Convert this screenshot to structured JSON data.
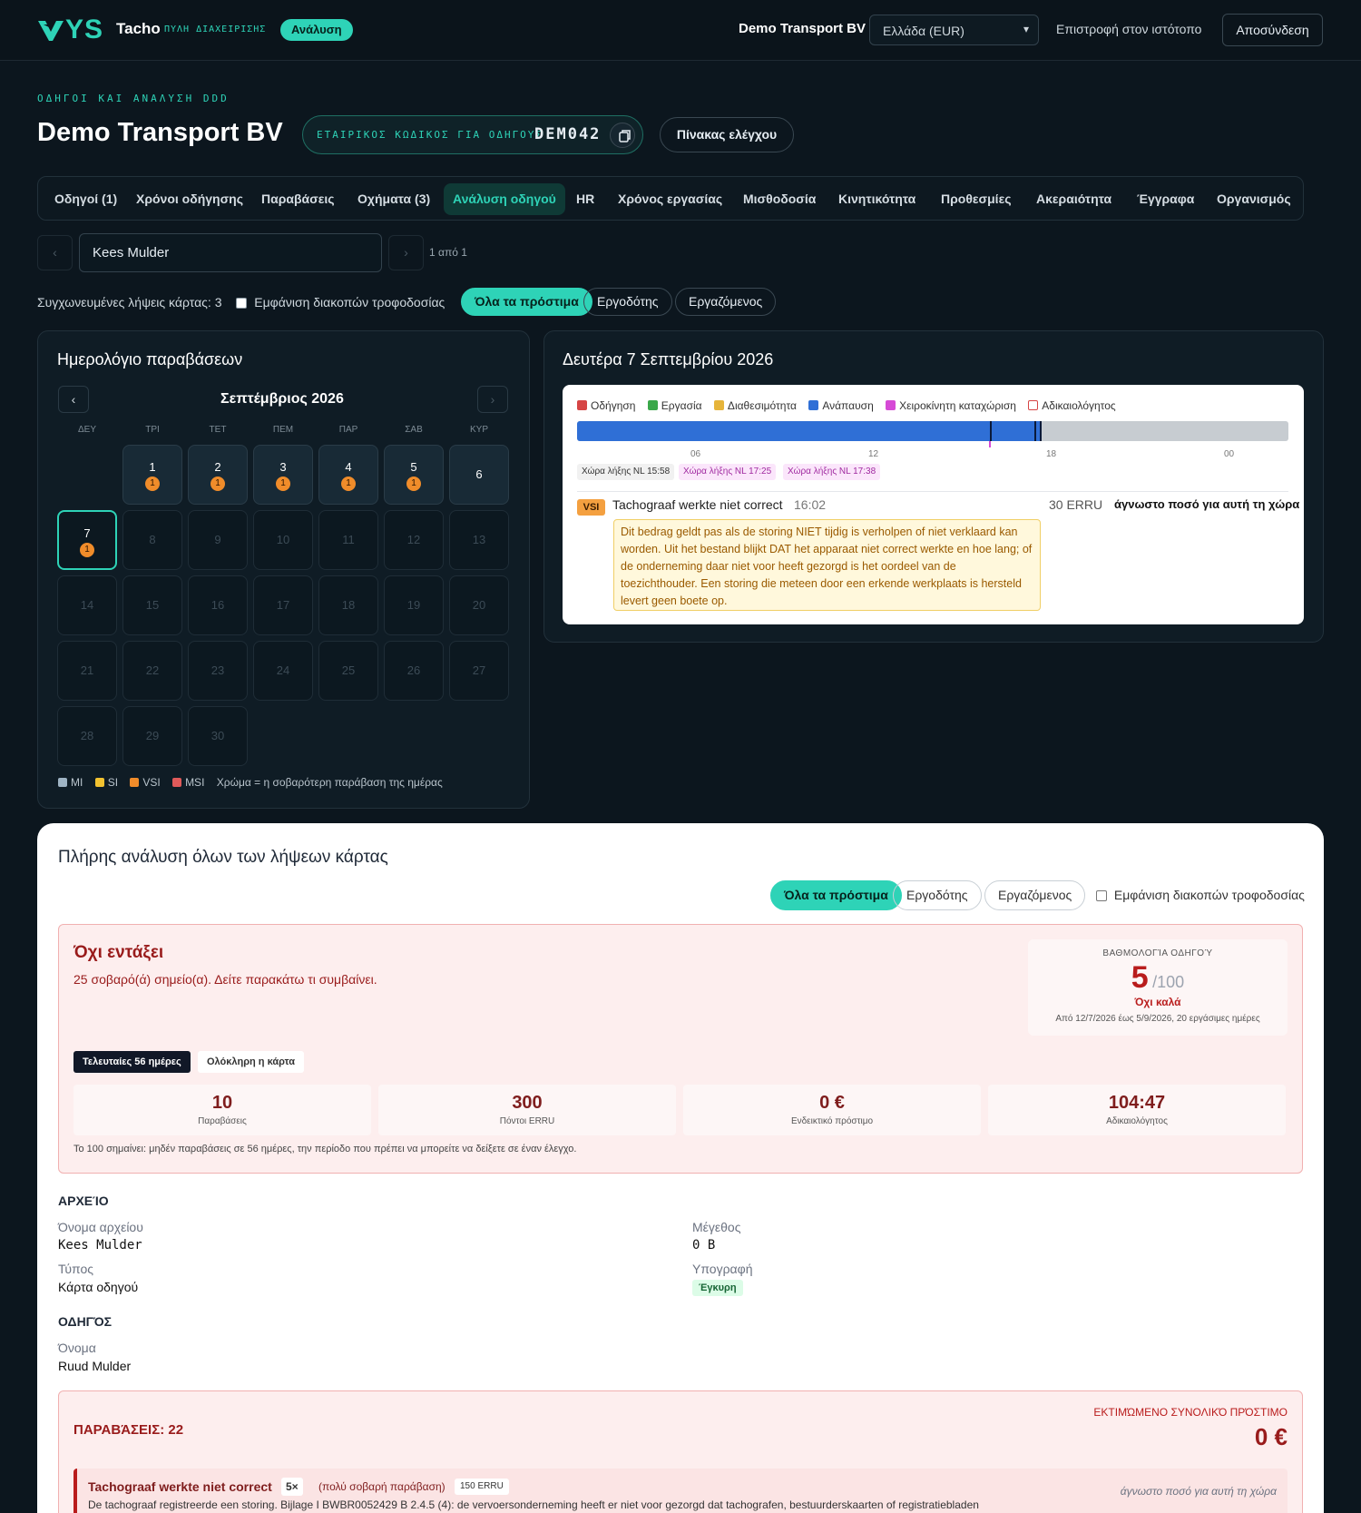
{
  "topbar": {
    "logo_text": "YS",
    "brand": "Tacho",
    "brand_sub": "ΠΥΛΗ ΔΙΑΧΕΙΡΙΣΗΣ",
    "mode_badge": "Ανάλυση",
    "company": "Demo Transport BV",
    "country_select": "Ελλάδα (EUR)",
    "back_link": "Επιστροφή στον ιστότοπο",
    "logout": "Αποσύνδεση"
  },
  "header": {
    "eyebrow": "ΟΔΗΓΟΙ ΚΑΙ ΑΝΑΛΥΣΗ DDD",
    "title": "Demo Transport BV",
    "code_label": "ΕΤΑΙΡΙΚΟΣ ΚΩΔΙΚΟΣ ΓΙΑ ΟΔΗΓΟΥΣ",
    "code_value": "DEM042",
    "dashboard_button": "Πίνακας ελέγχου"
  },
  "tabs": [
    {
      "label": "Οδηγοί (1)"
    },
    {
      "label": "Χρόνοι οδήγησης"
    },
    {
      "label": "Παραβάσεις"
    },
    {
      "label": "Οχήματα (3)"
    },
    {
      "label": "Ανάλυση οδηγού",
      "active": true
    },
    {
      "label": "HR"
    },
    {
      "label": "Χρόνος εργασίας"
    },
    {
      "label": "Μισθοδοσία"
    },
    {
      "label": "Κινητικότητα"
    },
    {
      "label": "Προθεσμίες"
    },
    {
      "label": "Ακεραιότητα"
    },
    {
      "label": "Έγγραφα"
    },
    {
      "label": "Οργανισμός"
    }
  ],
  "driver_nav": {
    "prev": "‹",
    "next": "›",
    "driver": "Kees Mulder",
    "position": "1 από 1"
  },
  "filters": {
    "merged": "Συγχωνευμένες λήψεις κάρτας: 3",
    "show_rest": "Εμφάνιση διακοπών τροφοδοσίας",
    "chips": [
      "Όλα τα πρόστιμα",
      "Εργοδότης",
      "Εργαζόμενος"
    ]
  },
  "calendar": {
    "title": "Ημερολόγιο παραβάσεων",
    "month": "Σεπτέμβριος 2026",
    "prev": "‹",
    "next": "›",
    "weekdays": [
      "ΔΕΥ",
      "ΤΡΙ",
      "ΤΕΤ",
      "ΠΕΜ",
      "ΠΑΡ",
      "ΣΑΒ",
      "ΚΥΡ"
    ],
    "days": [
      {
        "d": "1",
        "badge": "1"
      },
      {
        "d": "2",
        "badge": "1"
      },
      {
        "d": "3",
        "badge": "1"
      },
      {
        "d": "4",
        "badge": "1"
      },
      {
        "d": "5",
        "badge": "1"
      },
      {
        "d": "6"
      },
      {
        "d": "7",
        "badge": "1"
      },
      {
        "d": "8"
      },
      {
        "d": "9"
      },
      {
        "d": "10"
      },
      {
        "d": "11"
      },
      {
        "d": "12"
      },
      {
        "d": "13"
      },
      {
        "d": "14"
      },
      {
        "d": "15"
      },
      {
        "d": "16"
      },
      {
        "d": "17"
      },
      {
        "d": "18"
      },
      {
        "d": "19"
      },
      {
        "d": "20"
      },
      {
        "d": "21"
      },
      {
        "d": "22"
      },
      {
        "d": "23"
      },
      {
        "d": "24"
      },
      {
        "d": "25"
      },
      {
        "d": "26"
      },
      {
        "d": "27"
      },
      {
        "d": "28"
      },
      {
        "d": "29"
      },
      {
        "d": "30"
      }
    ],
    "legend": [
      {
        "label": "MI",
        "color": "#9fb4c4"
      },
      {
        "label": "SI",
        "color": "#f2c230"
      },
      {
        "label": "VSI",
        "color": "#f08c2a"
      },
      {
        "label": "MSI",
        "color": "#e05a5a"
      }
    ],
    "legend_note": "Χρώμα = η σοβαρότερη παράβαση της ημέρας"
  },
  "day_detail": {
    "title": "Δευτέρα 7 Σεπτεμβρίου 2026",
    "legend": [
      {
        "label": "Οδήγηση",
        "color": "#d64545"
      },
      {
        "label": "Εργασία",
        "color": "#3aa84a"
      },
      {
        "label": "Διαθεσιμότητα",
        "color": "#e6b43a"
      },
      {
        "label": "Ανάπαυση",
        "color": "#2f6fd6"
      },
      {
        "label": "Χειροκίνητη καταχώριση",
        "color": "#d64ad6"
      },
      {
        "label": "Αδικαιολόγητος",
        "color": "#ffffff"
      }
    ],
    "ticks": [
      "06",
      "12",
      "18",
      "00"
    ],
    "downloads": [
      "Χώρα λήξης NL 15:58",
      "Χώρα λήξης NL 17:25",
      "Χώρα λήξης NL 17:38"
    ],
    "violation": {
      "severity": "VSI",
      "title": "Tachograaf werkte niet correct",
      "time": "16:02",
      "points": "30 ERRU",
      "fine": "άγνωστο ποσό για αυτή τη χώρα",
      "note": "Dit bedrag geldt pas als de storing NIET tijdig is verholpen of niet verklaard kan worden. Uit het bestand blijkt DAT het apparaat niet correct werkte en hoe lang; of de onderneming daar niet voor heeft gezorgd is het oordeel van de toezichthouder. Een storing die meteen door een erkende werkplaats is hersteld levert geen boete op."
    }
  },
  "analysis": {
    "title": "Πλήρης ανάλυση όλων των λήψεων κάρτας",
    "chips": [
      "Όλα τα πρόστιμα",
      "Εργοδότης",
      "Εργαζόμενος"
    ],
    "show_rest": "Εμφάνιση διακοπών τροφοδοσίας",
    "status_title": "Όχι εντάξει",
    "status_sub": "25 σοβαρό(ά) σημείο(α). Δείτε παρακάτω τι συμβαίνει.",
    "score_label": "ΒΑΘΜΟΛΟΓΊΑ ΟΔΗΓΟΎ",
    "score": "5",
    "score_max": "/100",
    "score_verdict": "Όχι καλά",
    "score_period": "Από 12/7/2026 έως 5/9/2026, 20 εργάσιμες ημέρες",
    "segments": [
      "Τελευταίες 56 ημέρες",
      "Ολόκληρη η κάρτα"
    ],
    "stats": [
      {
        "value": "10",
        "label": "Παραβάσεις"
      },
      {
        "value": "300",
        "label": "Πόντοι ERRU"
      },
      {
        "value": "0 €",
        "label": "Ενδεικτικό πρόστιμο"
      },
      {
        "value": "104:47",
        "label": "Αδικαιολόγητος"
      }
    ],
    "footnote": "Το 100 σημαίνει: μηδέν παραβάσεις σε 56 ημέρες, την περίοδο που πρέπει να μπορείτε να δείξετε σε έναν έλεγχο.",
    "file_section": "ΑΡΧΕΊΟ",
    "file_name_label": "Όνομα αρχείου",
    "file_name": "Kees Mulder",
    "size_label": "Μέγεθος",
    "size": "0 B",
    "type_label": "Τύπος",
    "type": "Κάρτα οδηγού",
    "signature_label": "Υπογραφή",
    "signature": "Έγκυρη",
    "driver_section": "ΟΔΗΓΌΣ",
    "driver_name_label": "Όνομα",
    "driver_name": "Ruud Mulder",
    "violations_title": "ΠΑΡΑΒΆΣΕΙΣ",
    "violations_count": "22",
    "est_fine_label": "ΕΚΤΙΜΏΜΕΝΟ ΣΥΝΟΛΙΚΌ ΠΡΌΣΤΙΜΟ",
    "est_fine": "0 €",
    "item": {
      "title": "Tachograaf werkte niet correct",
      "count": "5×",
      "severity": "(πολύ σοβαρή παράβαση)",
      "points": "150 ERRU",
      "fine": "άγνωστο ποσό για αυτή τη χώρα",
      "desc": "De tachograaf registreerde een storing. Bijlage I BWBR0052429 B 2.4.5 (4): de vervoersonderneming heeft er niet voor gezorgd dat tachografen, bestuurderskaarten of registratiebladen"
    }
  }
}
